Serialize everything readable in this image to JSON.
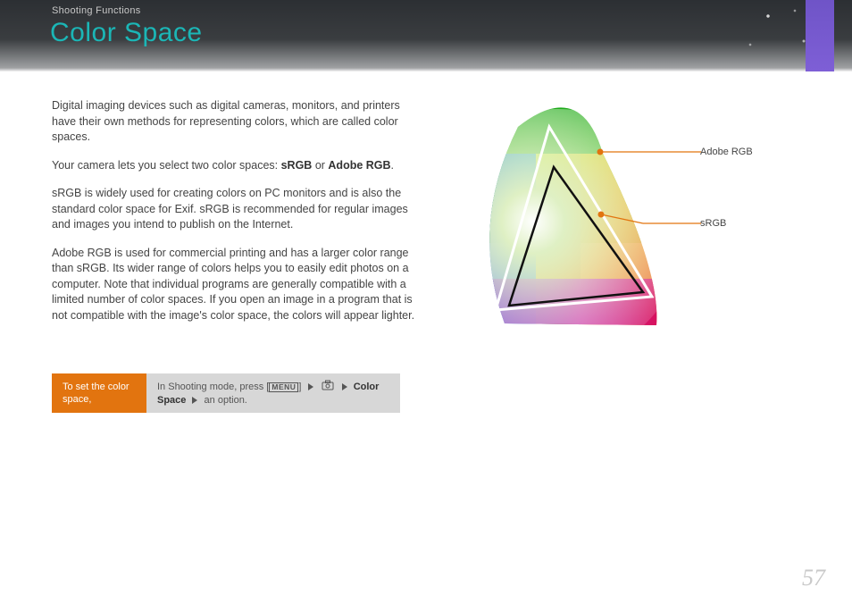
{
  "header": {
    "breadcrumb": "Shooting Functions",
    "title": "Color Space"
  },
  "body": {
    "p1": "Digital imaging devices such as digital cameras, monitors, and printers have their own methods for representing colors, which are called color spaces.",
    "p2_a": "Your camera lets you select two color spaces: ",
    "p2_b": "sRGB",
    "p2_c": " or ",
    "p2_d": "Adobe RGB",
    "p2_e": ".",
    "p3": "sRGB is widely used for creating colors on PC monitors and is also the standard color space for Exif. sRGB is recommended for regular images and images you intend to publish on the Internet.",
    "p4": "Adobe RGB is used for commercial printing and has a larger color range than sRGB. Its wider range of colors helps you to easily edit photos on a computer. Note that individual programs are generally compatible with a limited number of color spaces. If you open an image in a program that is not compatible with the image's color space, the colors will appear lighter."
  },
  "instruction": {
    "left": "To set the color space,",
    "right_a": "In Shooting mode, press [",
    "menu": "MENU",
    "right_b": "] ",
    "cs": "Color Space",
    "right_c": " an option."
  },
  "diagram": {
    "label_adobe": "Adobe RGB",
    "label_srgb": "sRGB"
  },
  "page": "57"
}
